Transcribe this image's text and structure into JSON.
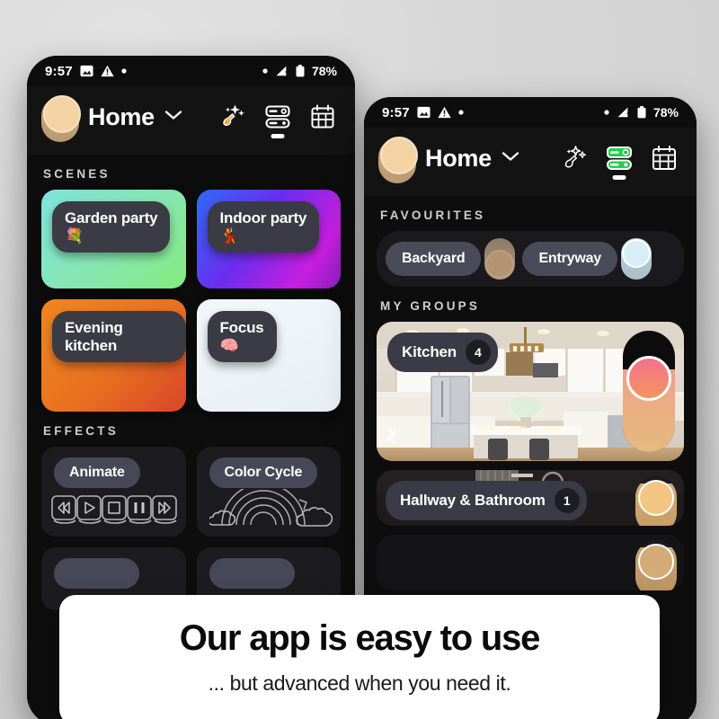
{
  "background": {
    "color": "#d6d6d6"
  },
  "caption": {
    "title": "Our app is easy to use",
    "subtitle": "... but advanced when you need it."
  },
  "phone_left": {
    "status_bar": {
      "time": "9:57",
      "battery_percent": "78%",
      "left_icons": [
        "image-icon",
        "warning-triangle-icon",
        "dot-icon"
      ],
      "right_icons": [
        "dot-icon",
        "signal-icon",
        "battery-icon"
      ]
    },
    "header": {
      "title": "Home",
      "chevron": "chevron-down-icon",
      "avatar": "avatar",
      "actions": [
        "magic-wand-icon",
        "devices-icon",
        "calendar-icon"
      ],
      "active_action": "devices-icon"
    },
    "sections": [
      {
        "label": "SCENES",
        "scenes": [
          {
            "name": "Garden party",
            "emoji": "💐",
            "gradient_from": "#7fe3dd",
            "gradient_to": "#83ec7d"
          },
          {
            "name": "Indoor party",
            "emoji": "💃",
            "gradient_from": "#2f6bf5",
            "gradient_to": "#c81fe0"
          },
          {
            "name": "Evening kitchen",
            "emoji": "",
            "gradient_from": "#f0871f",
            "gradient_to": "#d8452a"
          },
          {
            "name": "Focus",
            "emoji": "🧠",
            "gradient_from": "#eef4f8",
            "gradient_to": "#e6eef4"
          }
        ]
      },
      {
        "label": "EFFECTS",
        "effects": [
          {
            "name": "Animate",
            "art": "media-controls-icon"
          },
          {
            "name": "Color Cycle",
            "art": "rainbow-cloud-icon"
          }
        ]
      }
    ]
  },
  "phone_right": {
    "status_bar": {
      "time": "9:57",
      "battery_percent": "78%",
      "left_icons": [
        "image-icon",
        "warning-triangle-icon",
        "dot-icon"
      ],
      "right_icons": [
        "dot-icon",
        "signal-icon",
        "battery-icon"
      ]
    },
    "header": {
      "title": "Home",
      "chevron": "chevron-down-icon",
      "avatar": "avatar",
      "actions": [
        "magic-wand-icon",
        "devices-icon",
        "calendar-icon"
      ],
      "active_action": "devices-icon",
      "active_color": "#24d14a"
    },
    "favourites": {
      "label": "FAVOURITES",
      "items": [
        {
          "name": "Backyard",
          "toggle_color": "#b99a72",
          "toggle_on": false
        },
        {
          "name": "Entryway",
          "toggle_color": "#c3dbe6",
          "toggle_on": true
        }
      ]
    },
    "my_groups": {
      "label": "MY GROUPS",
      "groups": [
        {
          "name": "Kitchen",
          "count": "4",
          "slider_level": 68,
          "expand": "expand-icon"
        },
        {
          "name": "Hallway & Bathroom",
          "count": "1",
          "slider_level": 88
        }
      ]
    }
  }
}
